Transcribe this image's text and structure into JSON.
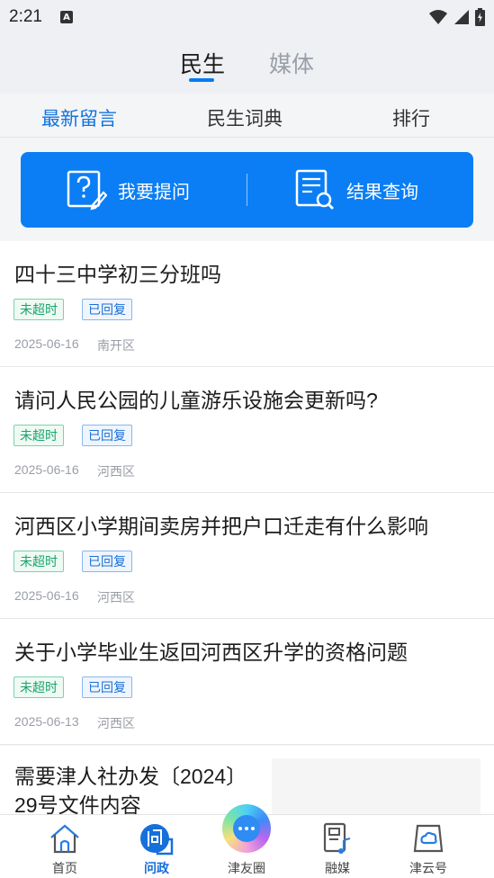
{
  "status_bar": {
    "time": "2:21",
    "notification_letter": "A"
  },
  "top_tabs": {
    "active": "民生",
    "inactive": "媒体"
  },
  "sub_tabs": [
    "最新留言",
    "民生词典",
    "排行"
  ],
  "actions": {
    "ask": "我要提问",
    "query": "结果查询"
  },
  "accent_color": "#0b7ef5",
  "items": [
    {
      "title": "四十三中学初三分班吗",
      "tag1": "未超时",
      "tag2": "已回复",
      "date": "2025-06-16",
      "district": "南开区"
    },
    {
      "title": "请问人民公园的儿童游乐设施会更新吗?",
      "tag1": "未超时",
      "tag2": "已回复",
      "date": "2025-06-16",
      "district": "河西区"
    },
    {
      "title": "河西区小学期间卖房并把户口迁走有什么影响",
      "tag1": "未超时",
      "tag2": "已回复",
      "date": "2025-06-16",
      "district": "河西区"
    },
    {
      "title": "关于小学毕业生返回河西区升学的资格问题",
      "tag1": "未超时",
      "tag2": "已回复",
      "date": "2025-06-13",
      "district": "河西区"
    }
  ],
  "partial_item": {
    "title": "需要津人社办发〔2024〕29号文件内容"
  },
  "bottom_nav": [
    {
      "label": "首页",
      "icon": "home-icon"
    },
    {
      "label": "问政",
      "icon": "wenzheng-icon"
    },
    {
      "label": "津友圈",
      "icon": "chat-bubble-icon"
    },
    {
      "label": "融媒",
      "icon": "media-icon"
    },
    {
      "label": "津云号",
      "icon": "cloud-icon"
    }
  ]
}
